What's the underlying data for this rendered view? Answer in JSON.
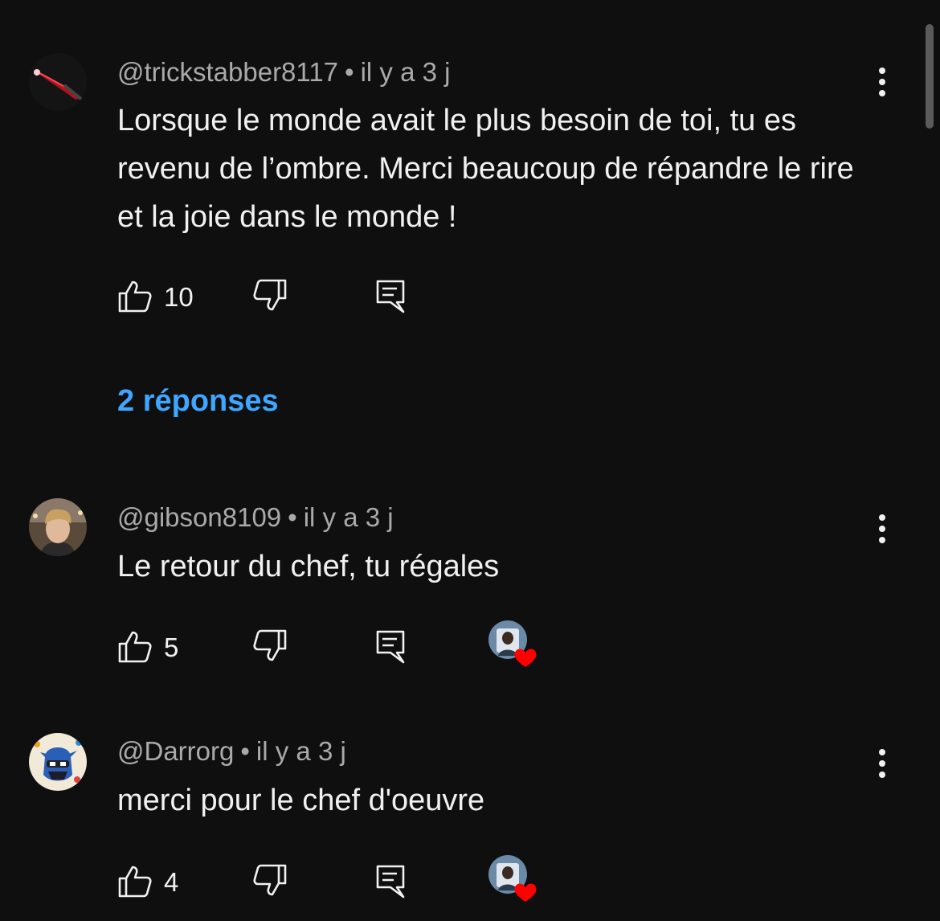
{
  "comments": [
    {
      "handle": "@trickstabber8117",
      "separator": "•",
      "time": "il y a 3 j",
      "text": "Lorsque le monde avait le plus besoin de toi, tu es revenu de l’ombre. Merci beaucoup de répandre le rire et la joie dans le monde !",
      "likes": "10",
      "avatar_icon": "red-blade-avatar",
      "creator_heart": false
    },
    {
      "handle": "@gibson8109",
      "separator": "•",
      "time": "il y a 3 j",
      "text": "Le retour du chef, tu régales",
      "likes": "5",
      "avatar_icon": "young-man-avatar",
      "creator_heart": true
    },
    {
      "handle": "@Darrorg",
      "separator": "•",
      "time": "il y a 3 j",
      "text": "merci pour le chef d'oeuvre",
      "likes": "4",
      "avatar_icon": "ninja-cartoon-avatar",
      "creator_heart": true
    }
  ],
  "replies_link": "2 réponses",
  "colors": {
    "background": "#0f0f0f",
    "text": "#f1f1f1",
    "meta": "#aaaaaa",
    "link": "#3ea6ff",
    "heart": "#ff0000"
  }
}
